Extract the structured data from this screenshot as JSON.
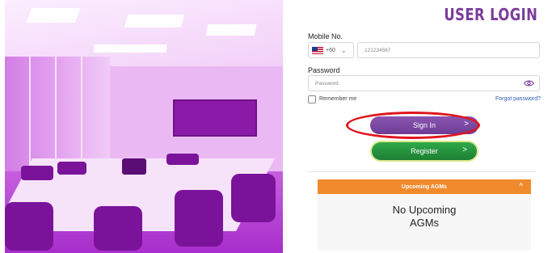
{
  "login": {
    "title": "USER LOGIN",
    "mobile_label": "Mobile No.",
    "country_code": "+60",
    "mobile_value": "121234567",
    "password_label": "Password",
    "password_placeholder": "Password",
    "remember_label": "Remember me",
    "forgot_label": "Forgot password?",
    "signin_label": "Sign In",
    "register_label": "Register",
    "arrow": ">"
  },
  "agms": {
    "header": "Upcoming AGMs",
    "caret": "^",
    "empty_line1": "No Upcoming",
    "empty_line2": "AGMs"
  },
  "colors": {
    "title": "#7b3b9b",
    "signin": "#7a48a3",
    "register": "#27963f",
    "agm_header": "#f08a2c",
    "annotation": "#e0151b"
  }
}
